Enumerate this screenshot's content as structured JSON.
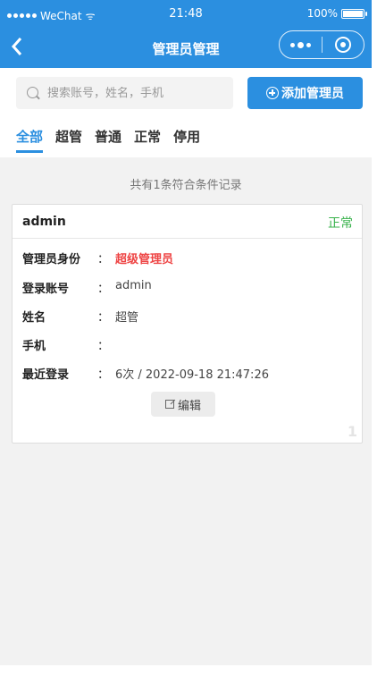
{
  "status_bar": {
    "carrier": "WeChat",
    "time": "21:48",
    "battery": "100%"
  },
  "nav": {
    "title": "管理员管理"
  },
  "search": {
    "placeholder": "搜索账号，姓名，手机",
    "value": ""
  },
  "add_button": {
    "label": "添加管理员"
  },
  "tabs": [
    {
      "label": "全部",
      "active": true
    },
    {
      "label": "超管"
    },
    {
      "label": "普通"
    },
    {
      "label": "正常"
    },
    {
      "label": "停用"
    }
  ],
  "summary": "共有1条符合条件记录",
  "records": [
    {
      "name": "admin",
      "status": "正常",
      "fields": [
        {
          "label": "管理员身份",
          "value": "超级管理员",
          "highlight": true
        },
        {
          "label": "登录账号",
          "value": "admin"
        },
        {
          "label": "姓名",
          "value": "超管"
        },
        {
          "label": "手机",
          "value": ""
        },
        {
          "label": "最近登录",
          "value": "6次 / 2022-09-18 21:47:26"
        }
      ],
      "edit_label": "编辑",
      "index": "1"
    }
  ],
  "colors": {
    "primary": "#2b8fe0",
    "status_ok": "#38b24b",
    "highlight": "#ee4444"
  }
}
